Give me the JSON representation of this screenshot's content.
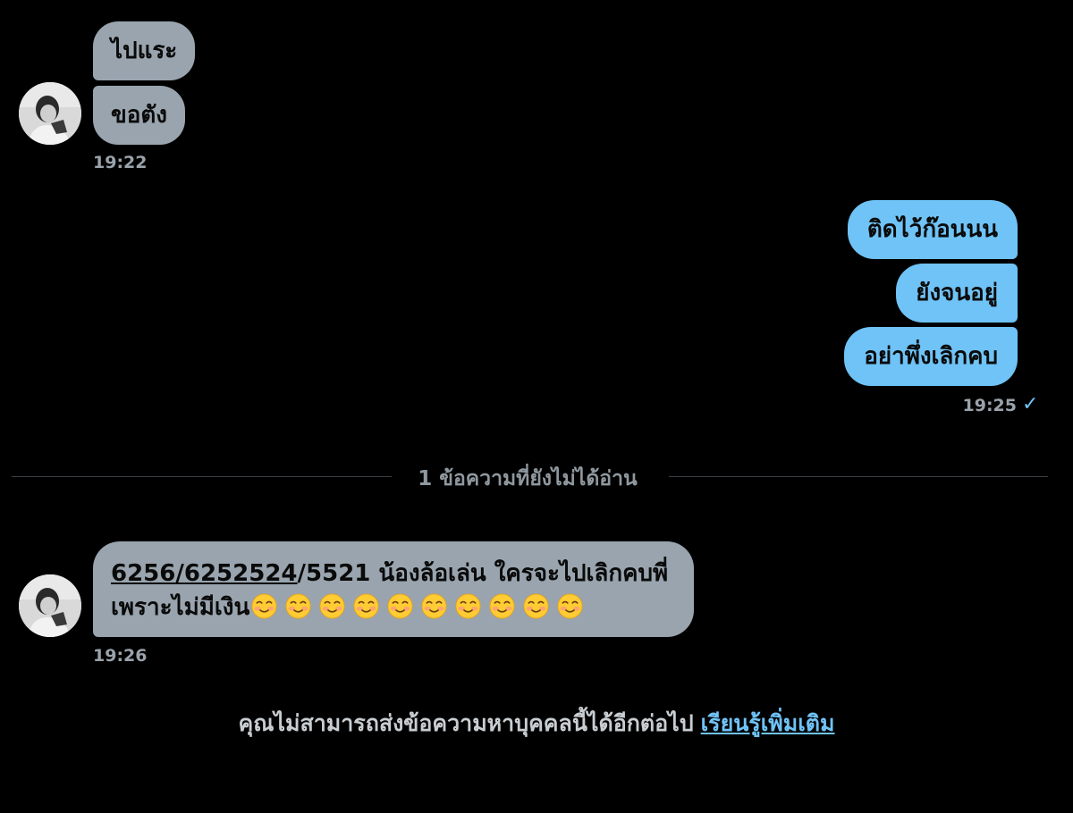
{
  "thread": {
    "group1": {
      "messages": [
        "ไปแระ",
        "ขอตัง"
      ],
      "time": "19:22"
    },
    "group2": {
      "messages": [
        "ติดไว้ก๊อนนน",
        "ยังจนอยู่",
        "อย่าพึ่งเลิกคบ"
      ],
      "time": "19:25",
      "status_icon": "check-icon"
    },
    "divider": {
      "text": "1 ข้อความที่ยังไม่ได้อ่าน"
    },
    "group3": {
      "message": {
        "num1": "6256",
        "sep1": "/",
        "num2": "6252524",
        "rest": "/5521 น้องล้อเล่น ใครจะไปเลิกคบพี่",
        "line2": "เพราะไม่มีเงิน",
        "emoji_icon": "smiling-face-icon",
        "emoji_count": 10
      },
      "time": "19:26"
    }
  },
  "footer": {
    "text": "คุณไม่สามารถส่งข้อความหาบุคคลนี้ได้อีกต่อไป",
    "link": "เรียนรู้เพิ่มเติม"
  },
  "colors": {
    "background": "#000000",
    "incoming_bubble": "#99a4ae",
    "outgoing_bubble": "#6fc3f6",
    "timestamp": "#9aa3ab",
    "link": "#6fc3f6"
  }
}
